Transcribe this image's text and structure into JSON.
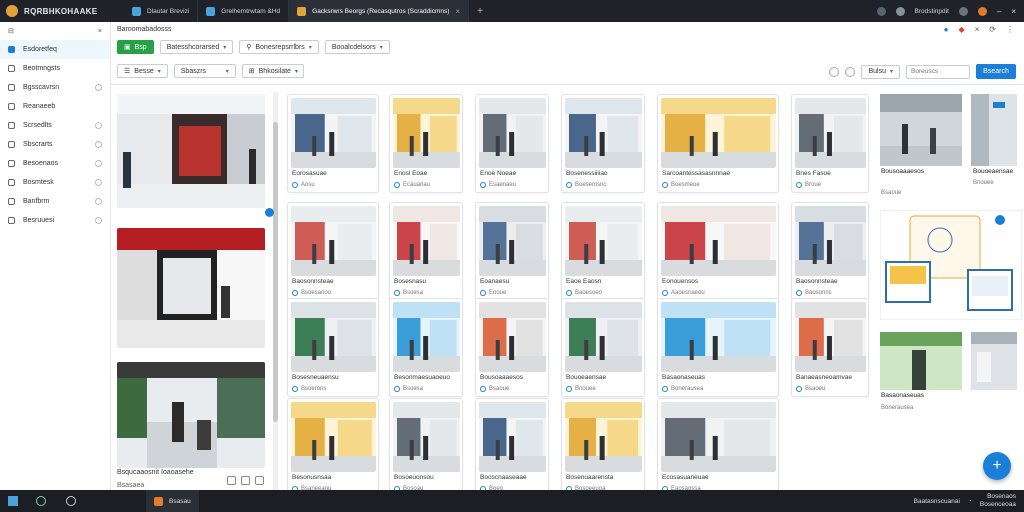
{
  "titlebar": {
    "app_title": "RQRBHKOHAAKE",
    "tabs": [
      {
        "label": "Dlautar Brevizi",
        "active": false
      },
      {
        "label": "Grelhemtrwtam &Hd",
        "active": false
      },
      {
        "label": "Gacksrwrs Beorgs (Recasqutros (Scraddicmns)",
        "active": true
      }
    ],
    "user_label": "Brodstinpdit"
  },
  "sidebar": {
    "items": [
      {
        "label": "Esdoretfeq",
        "icon": "home-icon",
        "active": true
      },
      {
        "label": "Beotmngsts",
        "icon": "grid-icon",
        "active": false
      },
      {
        "label": "Bgsscavrsn",
        "icon": "image-icon",
        "active": false
      },
      {
        "label": "Reanaeeb",
        "icon": "folder-icon",
        "active": false
      },
      {
        "label": "Scrsedlts",
        "icon": "tag-icon",
        "active": false
      },
      {
        "label": "Sbscrarts",
        "icon": "user-icon",
        "active": false
      },
      {
        "label": "Besoenaos",
        "icon": "chart-icon",
        "active": false
      },
      {
        "label": "Bosmtesk",
        "icon": "star-icon",
        "active": false
      },
      {
        "label": "Banfbrm",
        "icon": "gear-icon",
        "active": false
      },
      {
        "label": "Besruuesi",
        "icon": "help-icon",
        "active": false
      }
    ]
  },
  "header": {
    "breadcrumb": "Baroomabadosss"
  },
  "toolbar": {
    "new_button": "Bsp",
    "filter1": "Batesshcorarsed",
    "filter2": "Bonesrepsrrlbrs",
    "filter3": "Booalcdelsors",
    "view1": "Besse",
    "view2": "Sbaszrs",
    "view3": "Bhkosilate",
    "sort_label": "Bulsu",
    "search_placeholder": "Boreuscs",
    "search_button": "Bsearch"
  },
  "preview": {
    "caption": "Bsqucaaosnit Ioaoasehe",
    "meta": "Bsasaea"
  },
  "cards": [
    {
      "cap": "Eorosasuae",
      "meta": "Aosu"
    },
    {
      "cap": "Enosl Eoae",
      "meta": "Ecauanau"
    },
    {
      "cap": "Enoe Noeae",
      "meta": "Esaenaeu"
    },
    {
      "cap": "Bosenessiiiiao",
      "meta": "Boesemsnc"
    },
    {
      "cap": "Sarcoantessasasnnnae",
      "meta": "Boesmeue"
    },
    {
      "cap": "Bnes Fasoe",
      "meta": "Broue"
    },
    {
      "cap": "Baosonnsteae",
      "meta": "Bsoesanoo"
    },
    {
      "cap": "Bosesnasu",
      "meta": "Bsoesa"
    },
    {
      "cap": "Eoanaesu",
      "meta": "Enoue"
    },
    {
      "cap": "Eaoe Eaosn",
      "meta": "Baoesoeo"
    },
    {
      "cap": "Eonouensos",
      "meta": "Aaoesnaeou"
    },
    {
      "cap": "Baosonnsteae",
      "meta": "Baosonnc"
    },
    {
      "cap": "Bosesneuaensu",
      "meta": "Bsoerons"
    },
    {
      "cap": "Besonmaesuaoeuo",
      "meta": "Bsoesa"
    },
    {
      "cap": "Bousoaaaesos",
      "meta": "Bsaoue"
    },
    {
      "cap": "Bouoeaensae",
      "meta": "Bnouee"
    },
    {
      "cap": "Basaonaseuas",
      "meta": "Bonerausea"
    },
    {
      "cap": "Banaeasneoamvae",
      "meta": "Bsaoeu"
    },
    {
      "cap": "Besonusnsaa",
      "meta": "Bsaneeanu"
    },
    {
      "cap": "Bosoeuonsou",
      "meta": "Bosoau"
    },
    {
      "cap": "Booscnaaseaae",
      "meta": "Boeo"
    },
    {
      "cap": "Bosenuaarensta",
      "meta": "Bosoeeuoa"
    },
    {
      "cap": "Ecosasuaneuae",
      "meta": "Eaosaossa"
    },
    {
      "cap": "Eceaanenanoseemsuasnusoa",
      "meta": "Baoansss"
    },
    {
      "cap": "Bounoaesue",
      "meta": "Bsoaceu"
    },
    {
      "cap": "Eonoesuaesse",
      "meta": "Boesaeueco"
    },
    {
      "cap": "Banoaesuaesue",
      "meta": "Eoanaseu"
    },
    {
      "cap": "Bseeeoee",
      "meta": "Bneusaa"
    }
  ],
  "taskbar": {
    "app_label": "Bsasau",
    "tray_text": "Baatasnscuanai",
    "time": "Bosenaos",
    "date": "Bosenceoaa"
  },
  "colors": {
    "accent": "#1a7fd6",
    "green": "#27a046",
    "titlebar": "#1f2329"
  }
}
